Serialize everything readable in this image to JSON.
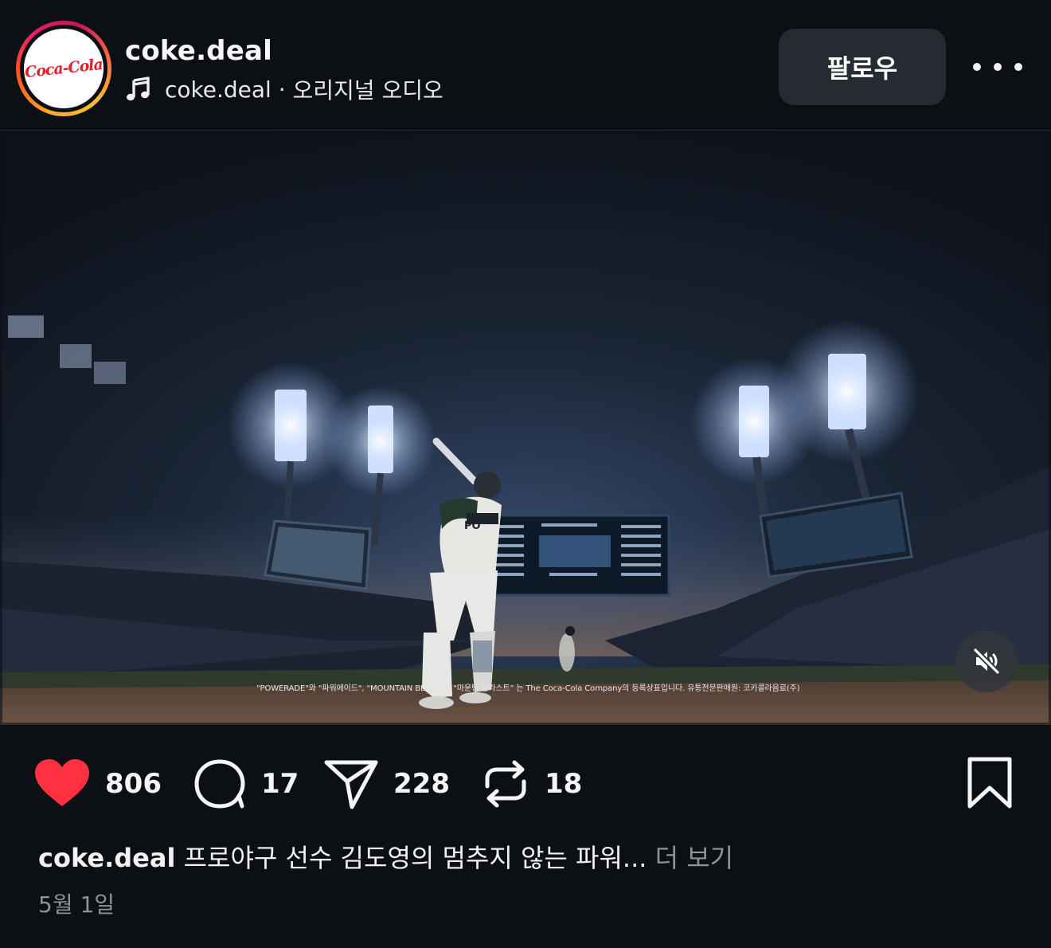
{
  "header": {
    "username": "coke.deal",
    "avatar_logo_text": "Coca-Cola",
    "audio_account": "coke.deal",
    "audio_separator": " · ",
    "audio_label": "오리지널 오디오",
    "follow_label": "팔로우"
  },
  "video": {
    "trademark_notice": "\"POWERADE\"와 \"파워에이드\", \"MOUNTAIN BLAST\"와 \"마운틴 블라스트\" 는 The Coca-Cola Company의 등록상표입니다. 유통전문판매원: 코카콜라음료(주)",
    "muted": true
  },
  "actions": {
    "likes": "806",
    "comments": "17",
    "shares": "228",
    "reposts": "18",
    "liked": true
  },
  "caption": {
    "username": "coke.deal",
    "text": " 프로야구 선수 김도영의 멈추지 않는 파워... ",
    "more_label": "더 보기"
  },
  "date": "5월 1일",
  "colors": {
    "background": "#0c0f14",
    "like_red": "#ff3040",
    "follow_button": "#262a31",
    "muted_text": "#8e939a"
  },
  "icons": [
    "music-note-icon",
    "more-dots-icon",
    "mute-icon",
    "heart-icon",
    "comment-icon",
    "share-icon",
    "repost-icon",
    "bookmark-icon"
  ]
}
